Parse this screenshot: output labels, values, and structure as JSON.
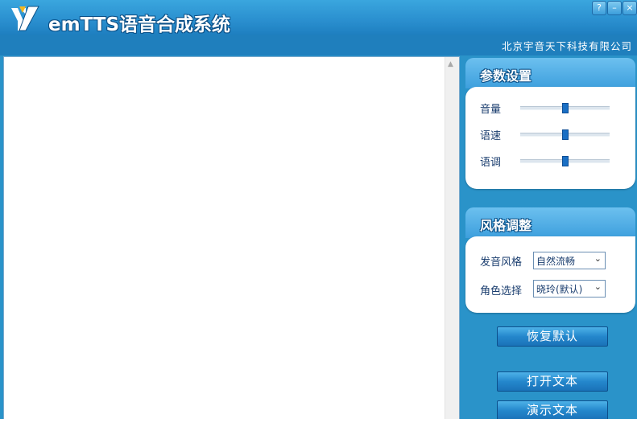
{
  "window": {
    "title": "emTTS语音合成系统",
    "company": "北京宇音天下科技有限公司",
    "controls": {
      "help": "?",
      "minimize": "–",
      "close": "×"
    }
  },
  "editor": {
    "content": ""
  },
  "params_panel": {
    "title": "参数设置",
    "sliders": [
      {
        "label": "音量",
        "value": 0.5
      },
      {
        "label": "语速",
        "value": 0.5
      },
      {
        "label": "语调",
        "value": 0.5
      }
    ]
  },
  "style_panel": {
    "title": "风格调整",
    "voice_style_label": "发音风格",
    "voice_style_value": "自然流畅",
    "role_label": "角色选择",
    "role_value": "晓玲(默认)"
  },
  "buttons": {
    "restore_default": "恢复默认",
    "open_text": "打开文本",
    "demo_text": "演示文本"
  },
  "colors": {
    "accent": "#2a93c9",
    "button": "#2487cc"
  }
}
